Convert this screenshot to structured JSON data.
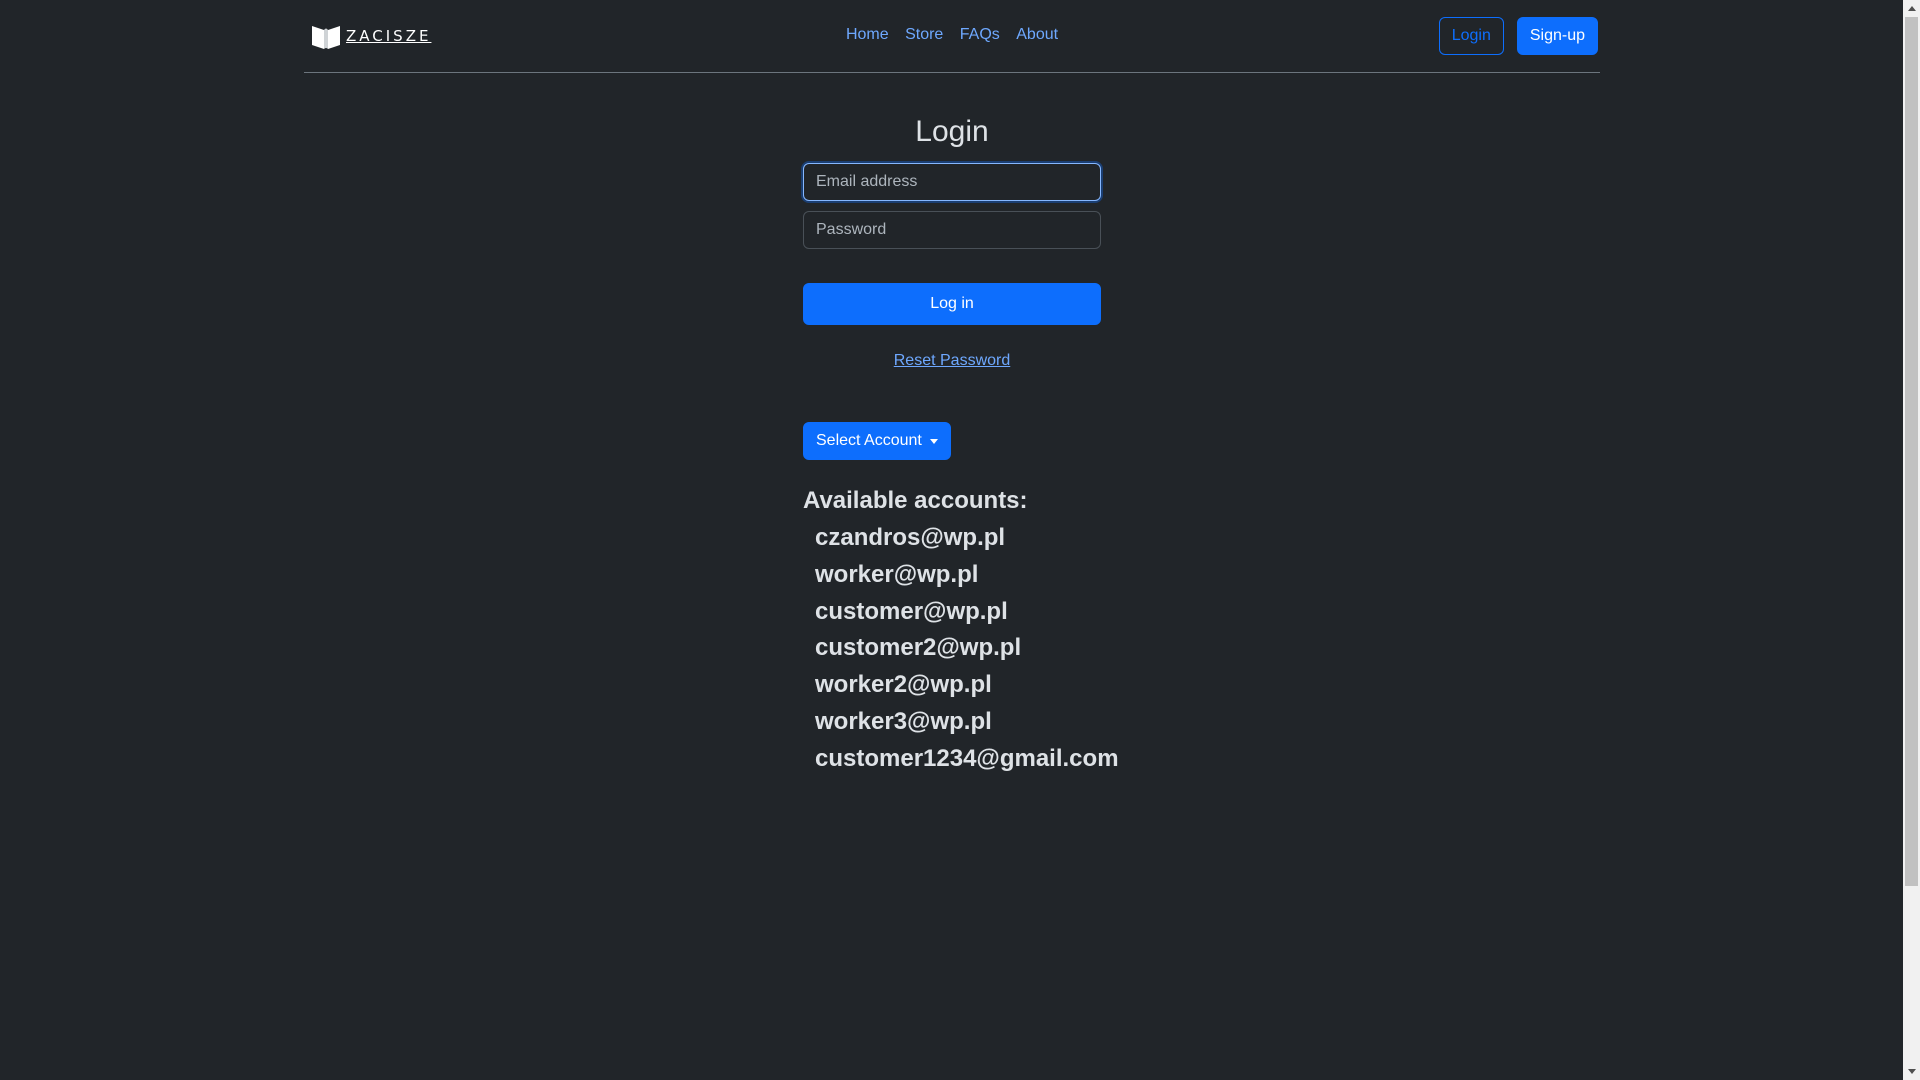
{
  "header": {
    "logo_text": "ZACISZE",
    "logo_icon": "open-book-icon",
    "nav": [
      {
        "label": "Home"
      },
      {
        "label": "Store"
      },
      {
        "label": "FAQs"
      },
      {
        "label": "About"
      }
    ],
    "login_label": "Login",
    "signup_label": "Sign-up"
  },
  "form": {
    "title": "Login",
    "email": {
      "value": "",
      "placeholder": "Email address"
    },
    "password": {
      "value": "",
      "placeholder": "Password"
    },
    "submit_label": "Log in",
    "reset_label": "Reset Password"
  },
  "accounts": {
    "select_label": "Select Account",
    "heading": "Available accounts:",
    "items": [
      "czandros@wp.pl",
      "worker@wp.pl",
      "customer@wp.pl",
      "customer2@wp.pl",
      "worker2@wp.pl",
      "worker3@wp.pl",
      "customer1234@gmail.com"
    ]
  },
  "colors": {
    "background": "#212529",
    "primary": "#0d6efd",
    "link": "#6ea8fe",
    "text": "#dee2e6"
  }
}
